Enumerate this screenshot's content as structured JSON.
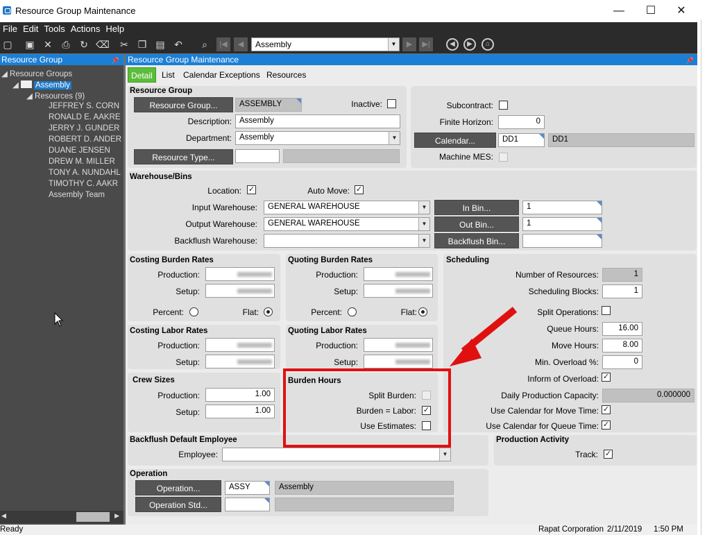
{
  "window": {
    "title": "Resource Group Maintenance",
    "minimize": "—",
    "maximize": "☐",
    "close": "✕"
  },
  "menu": [
    "File",
    "Edit",
    "Tools",
    "Actions",
    "Help"
  ],
  "toolbar": {
    "nav_value": "Assembly"
  },
  "tree": {
    "header": "Resource Group",
    "root": "Resource Groups",
    "selected": "Assembly",
    "resources_label": "Resources (9)",
    "resources": [
      "JEFFREY S. CORN",
      "RONALD E. AAKRE",
      "JERRY J. GUNDER",
      "ROBERT D. ANDER",
      "DUANE JENSEN",
      "DREW M. MILLER",
      "TONY A. NUNDAHL",
      "TIMOTHY C. AAKR",
      "Assembly Team"
    ]
  },
  "main": {
    "header": "Resource Group Maintenance",
    "tabs": [
      "Detail",
      "List",
      "Calendar Exceptions",
      "Resources"
    ]
  },
  "resource_group": {
    "title": "Resource Group",
    "group_button": "Resource Group...",
    "group_value": "ASSEMBLY",
    "inactive_label": "Inactive:",
    "description_label": "Description:",
    "description_value": "Assembly",
    "department_label": "Department:",
    "department_value": "Assembly",
    "resource_type_button": "Resource Type...",
    "subcontract_label": "Subcontract:",
    "finite_horizon_label": "Finite Horizon:",
    "finite_horizon_value": "0",
    "calendar_button": "Calendar...",
    "calendar_value": "DD1",
    "calendar_desc": "DD1",
    "machine_mes_label": "Machine MES:"
  },
  "warehouse": {
    "title": "Warehouse/Bins",
    "location_label": "Location:",
    "auto_move_label": "Auto Move:",
    "input_label": "Input Warehouse:",
    "input_value": "GENERAL WAREHOUSE",
    "output_label": "Output Warehouse:",
    "output_value": "GENERAL WAREHOUSE",
    "backflush_label": "Backflush Warehouse:",
    "in_bin_button": "In Bin...",
    "in_bin_value": "1",
    "out_bin_button": "Out Bin...",
    "out_bin_value": "1",
    "backflush_bin_button": "Backflush Bin..."
  },
  "costing_burden": {
    "title": "Costing Burden Rates",
    "production": "Production:",
    "setup": "Setup:",
    "percent": "Percent:",
    "flat": "Flat:"
  },
  "quoting_burden": {
    "title": "Quoting Burden Rates",
    "production": "Production:",
    "setup": "Setup:",
    "percent": "Percent:",
    "flat": "Flat:"
  },
  "costing_labor": {
    "title": "Costing Labor Rates",
    "production": "Production:",
    "setup": "Setup:"
  },
  "quoting_labor": {
    "title": "Quoting Labor Rates",
    "production": "Production:",
    "setup": "Setup:"
  },
  "crew": {
    "title": "Crew Sizes",
    "production": "Production:",
    "production_value": "1.00",
    "setup": "Setup:",
    "setup_value": "1.00"
  },
  "burden_hours": {
    "title": "Burden Hours",
    "split": "Split Burden:",
    "equal_labor": "Burden = Labor:",
    "use_estimates": "Use Estimates:"
  },
  "scheduling": {
    "title": "Scheduling",
    "num_resources_label": "Number of Resources:",
    "num_resources": "1",
    "blocks_label": "Scheduling Blocks:",
    "blocks": "1",
    "split_ops_label": "Split Operations:",
    "queue_label": "Queue Hours:",
    "queue": "16.00",
    "move_label": "Move Hours:",
    "move": "8.00",
    "min_overload_label": "Min. Overload %:",
    "min_overload": "0",
    "inform_label": "Inform of Overload:",
    "daily_capacity_label": "Daily Production Capacity:",
    "daily_capacity": "0.000000",
    "cal_move_label": "Use Calendar for Move Time:",
    "cal_queue_label": "Use Calendar for Queue Time:"
  },
  "backflush_employee": {
    "title": "Backflush Default Employee",
    "employee_label": "Employee:"
  },
  "production_activity": {
    "title": "Production Activity",
    "track_label": "Track:"
  },
  "operation": {
    "title": "Operation",
    "operation_button": "Operation...",
    "operation_value": "ASSY",
    "operation_desc": "Assembly",
    "std_button": "Operation Std..."
  },
  "status": {
    "left": "Ready",
    "company": "Rapat Corporation",
    "date": "2/11/2019",
    "time": "1:50 PM"
  },
  "colors": {
    "accent": "#1b7fd6",
    "annotation": "#e01010",
    "tab_active": "#5bbd3b"
  }
}
